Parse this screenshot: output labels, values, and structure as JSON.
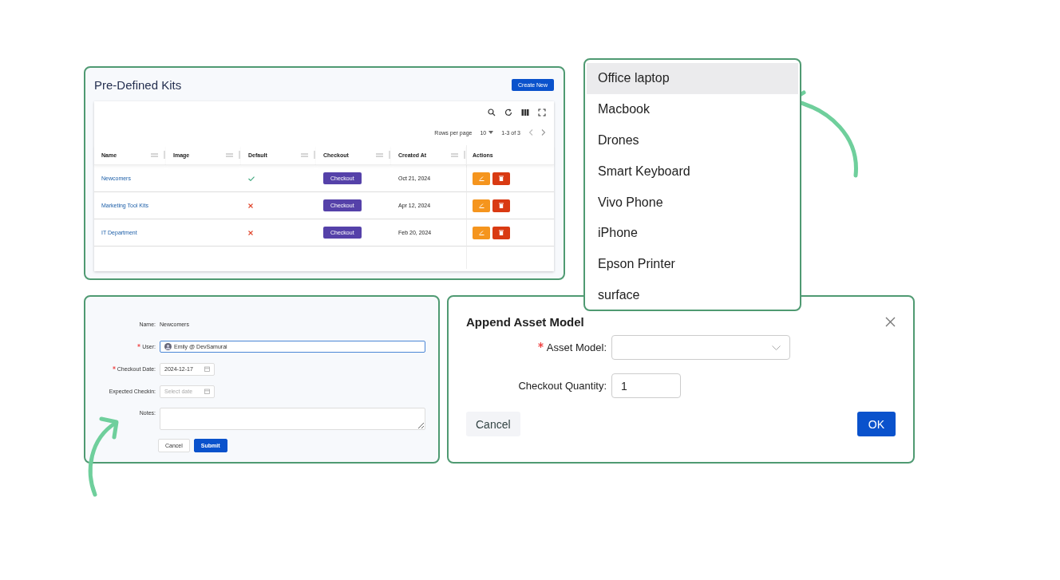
{
  "kits_panel": {
    "title": "Pre-Defined Kits",
    "create_button": "Create New",
    "pagination": {
      "rows_label": "Rows per page",
      "rows_value": "10",
      "range": "1-3 of 3"
    },
    "columns": [
      "Name",
      "Image",
      "Default",
      "Checkout",
      "Created At",
      "Actions"
    ],
    "rows": [
      {
        "name": "Newcomers",
        "default": true,
        "checkout": "Checkout",
        "created_at": "Oct 21, 2024"
      },
      {
        "name": "Marketing Tool Kits",
        "default": false,
        "checkout": "Checkout",
        "created_at": "Apr 12, 2024"
      },
      {
        "name": "IT Department",
        "default": false,
        "checkout": "Checkout",
        "created_at": "Feb 20, 2024"
      }
    ]
  },
  "checkout_form": {
    "fields": [
      {
        "kind": "text",
        "label": "Name:",
        "required": false,
        "value": "Newcomers"
      },
      {
        "kind": "user",
        "label": "User:",
        "required": true,
        "value": "Emily @ DevSamurai"
      },
      {
        "kind": "date",
        "label": "Checkout Date:",
        "required": true,
        "value": "2024-12-17"
      },
      {
        "kind": "date",
        "label": "Expected Checkin:",
        "required": false,
        "placeholder": "Select date"
      },
      {
        "kind": "textarea",
        "label": "Notes:",
        "required": false
      }
    ],
    "buttons": [
      "Cancel",
      "Submit"
    ]
  },
  "asset_dropdown": {
    "options": [
      {
        "label": "Office laptop",
        "selected": true
      },
      {
        "label": "Macbook",
        "selected": false
      },
      {
        "label": "Drones",
        "selected": false
      },
      {
        "label": "Smart Keyboard",
        "selected": false
      },
      {
        "label": "Vivo Phone",
        "selected": false
      },
      {
        "label": "iPhone",
        "selected": false
      },
      {
        "label": "Epson Printer",
        "selected": false
      },
      {
        "label": "surface",
        "selected": false
      }
    ]
  },
  "append_dialog": {
    "title": "Append Asset Model",
    "fields": [
      {
        "kind": "select",
        "label": "Asset Model:",
        "required": true
      },
      {
        "kind": "number",
        "label": "Checkout Quantity:",
        "required": false,
        "value": "1"
      }
    ],
    "buttons": [
      "Cancel",
      "OK"
    ]
  }
}
